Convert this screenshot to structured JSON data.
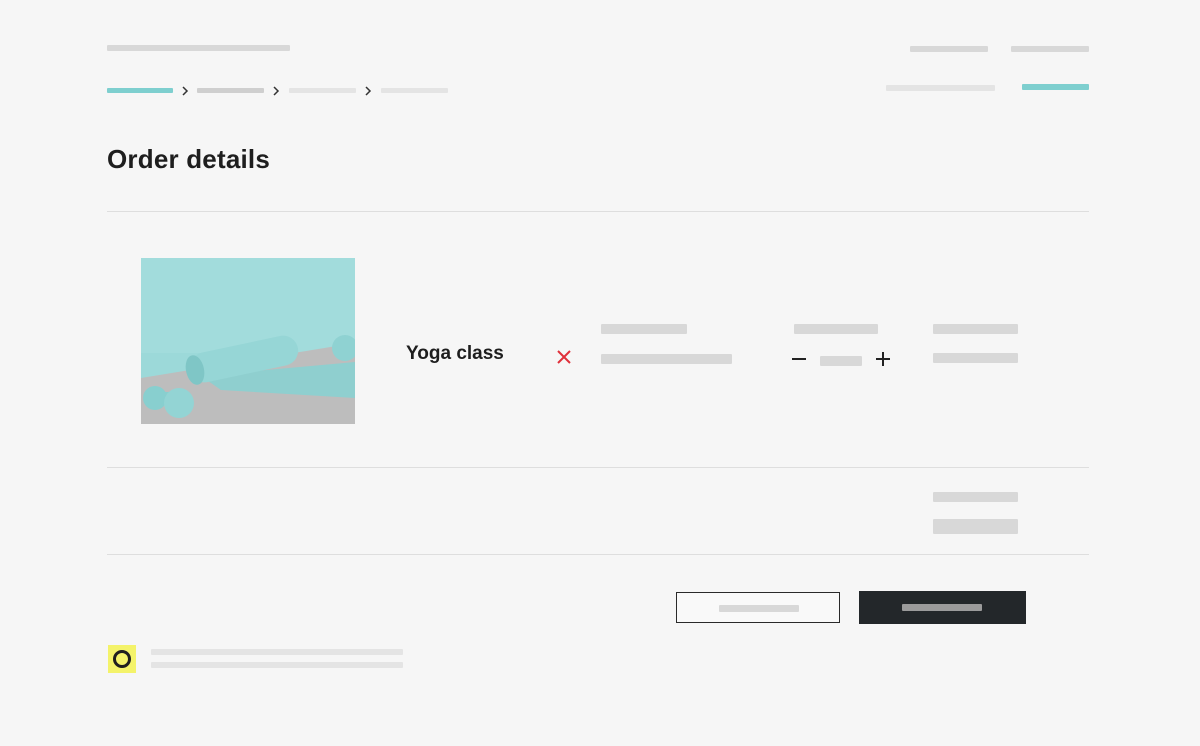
{
  "main": {
    "title": "Order details"
  },
  "cart": {
    "items": [
      {
        "name": "Yoga class"
      }
    ]
  },
  "colors": {
    "accent": "#7ecfcf",
    "remove": "#e0303a",
    "primary_button": "#23272a",
    "badge": "#f4f36a"
  },
  "icons": {
    "breadcrumb_separator": "chevron-right-icon",
    "remove": "close-icon",
    "decrement": "minus-icon",
    "increment": "plus-icon",
    "badge": "ring-icon"
  }
}
